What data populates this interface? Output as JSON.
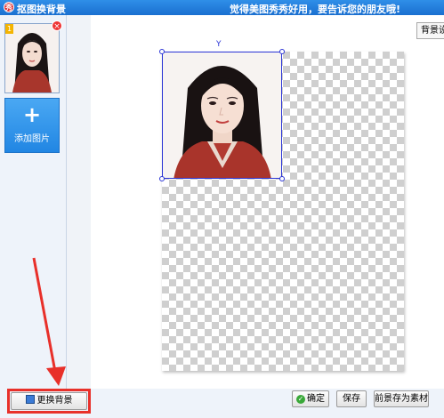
{
  "window": {
    "title": "抠图换背景",
    "slogan": "觉得美图秀秀好用，要告诉您的朋友哦!"
  },
  "sidebar": {
    "thumbnail_badge": "1",
    "close_glyph": "×",
    "add_image_icon": "+",
    "add_image_label": "添加图片"
  },
  "toolbar": {
    "background_settings_label": "背景设"
  },
  "canvas": {
    "rotate_handle_glyph": "Y"
  },
  "footer": {
    "change_background_label": "更换背景",
    "confirm_label": "确定",
    "confirm_icon": "✓",
    "save_label": "保存",
    "save_as_material_label": "前景存为素材"
  },
  "colors": {
    "titlebar": "#1a6fd0",
    "selection": "#2a34d6",
    "annotation": "#e8302a"
  }
}
